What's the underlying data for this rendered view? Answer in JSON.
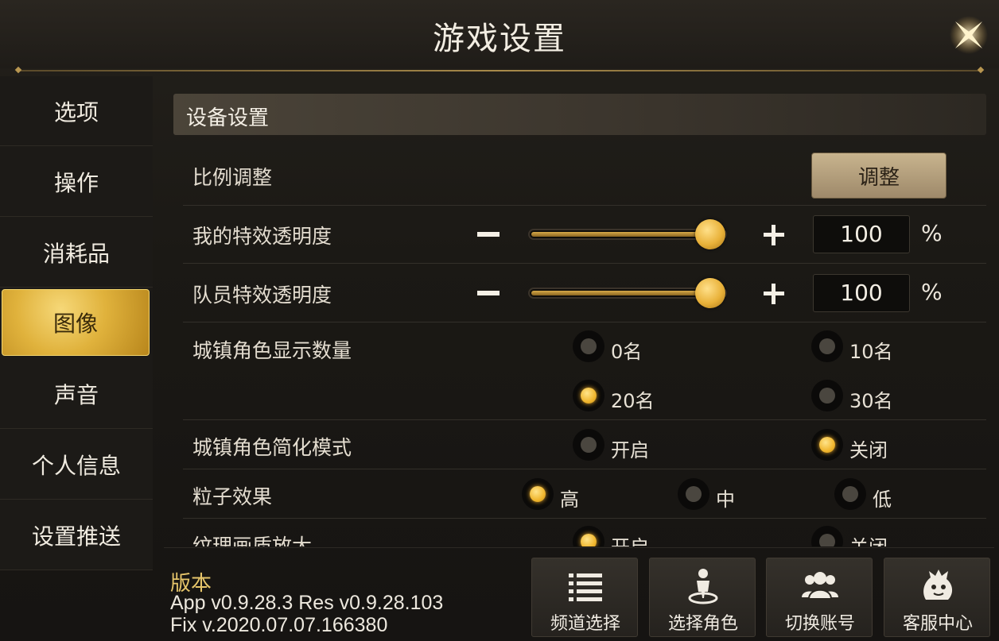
{
  "window": {
    "title": "游戏设置"
  },
  "sidebar": {
    "items": [
      {
        "label": "选项",
        "active": false
      },
      {
        "label": "操作",
        "active": false
      },
      {
        "label": "消耗品",
        "active": false
      },
      {
        "label": "图像",
        "active": true
      },
      {
        "label": "声音",
        "active": false
      },
      {
        "label": "个人信息",
        "active": false
      },
      {
        "label": "设置推送",
        "active": false
      }
    ]
  },
  "section": {
    "title": "设备设置"
  },
  "settings": {
    "scale": {
      "label": "比例调整",
      "button_label": "调整"
    },
    "my_effect_opacity": {
      "label": "我的特效透明度",
      "value": "100",
      "unit": "%",
      "level": 1.0
    },
    "party_effect_opacity": {
      "label": "队员特效透明度",
      "value": "100",
      "unit": "%",
      "level": 1.0
    },
    "town_character_count": {
      "label": "城镇角色显示数量",
      "options": [
        "0名",
        "10名",
        "20名",
        "30名"
      ],
      "selected": "20名"
    },
    "town_simplified_mode": {
      "label": "城镇角色简化模式",
      "options": [
        "开启",
        "关闭"
      ],
      "selected": "关闭"
    },
    "particle_effect": {
      "label": "粒子效果",
      "options": [
        "高",
        "中",
        "低"
      ],
      "selected": "高"
    },
    "texture_upscale": {
      "label": "纹理画质放大",
      "options": [
        "开启",
        "关闭"
      ],
      "selected": "开启"
    }
  },
  "footer": {
    "version_title": "版本",
    "version_line1": "App v0.9.28.3 Res v0.9.28.103",
    "version_line2": "Fix v.2020.07.07.166380",
    "buttons": [
      {
        "label": "频道选择",
        "icon": "list-icon"
      },
      {
        "label": "选择角色",
        "icon": "character-pin-icon"
      },
      {
        "label": "切换账号",
        "icon": "users-icon"
      },
      {
        "label": "客服中心",
        "icon": "mascot-icon"
      }
    ]
  },
  "colors": {
    "accent_gold": "#e0b23c",
    "version_title": "#e6c56a"
  }
}
